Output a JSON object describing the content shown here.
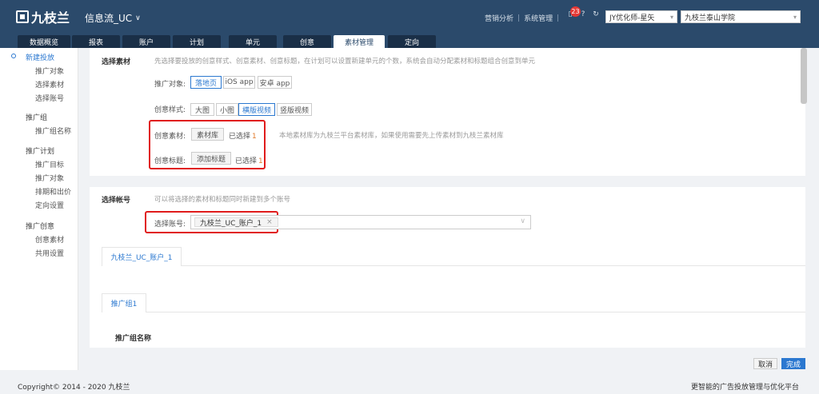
{
  "header": {
    "logo": "九枝兰",
    "product": "信息流_UC",
    "links": [
      "营销分析",
      "系统管理"
    ],
    "notification_count": "23",
    "user_select": "JY优化师-星矢",
    "org_select": "九枝兰泰山学院"
  },
  "tabs": [
    {
      "label": "数据概览"
    },
    {
      "label": "报表"
    },
    {
      "label": "账户"
    },
    {
      "label": "计划"
    },
    {
      "label": "单元"
    },
    {
      "label": "创意"
    },
    {
      "label": "素材管理"
    },
    {
      "label": "定向"
    }
  ],
  "sidebar": {
    "groups": [
      {
        "label": "新建投放",
        "items": [
          "推广对象",
          "选择素材",
          "选择账号"
        ]
      },
      {
        "label": "推广组",
        "items": [
          "推广组名称"
        ]
      },
      {
        "label": "推广计划",
        "items": [
          "推广目标",
          "推广对象",
          "排期和出价",
          "定向设置"
        ]
      },
      {
        "label": "推广创意",
        "items": [
          "创意素材",
          "共用设置"
        ]
      }
    ]
  },
  "material": {
    "title": "选择素材",
    "hint": "先选择要投放的创意样式、创意素材、创意标题，在计划可以设置新建单元的个数，系统会自动分配素材和标题组合创意到单元",
    "promo_label": "推广对象:",
    "promo_options": [
      "落地页",
      "iOS app",
      "安卓 app"
    ],
    "style_label": "创意样式:",
    "style_options": [
      "大图",
      "小图",
      "横版视频",
      "竖版视频"
    ],
    "creative_label": "创意素材:",
    "creative_btn": "素材库",
    "selected_label": "已选择",
    "creative_count": "1",
    "creative_hint": "本地素材库为九枝兰平台素材库，如果使用需要先上传素材到九枝兰素材库",
    "title_label": "创意标题:",
    "title_btn": "添加标题",
    "title_count": "1"
  },
  "account": {
    "title": "选择帐号",
    "hint": "可以将选择的素材和标题同时新建到多个账号",
    "select_label": "选择账号:",
    "selected_tag": "九枝兰_UC_账户_1",
    "tab_label": "九枝兰_UC_账户_1",
    "group_tab": "推广组1",
    "group_name_label": "推广组名称"
  },
  "actions": {
    "cancel": "取消",
    "done": "完成"
  },
  "footer": {
    "copyright": "Copyright© 2014 - 2020 九枝兰",
    "slogan": "更智能的广告投放管理与优化平台"
  }
}
